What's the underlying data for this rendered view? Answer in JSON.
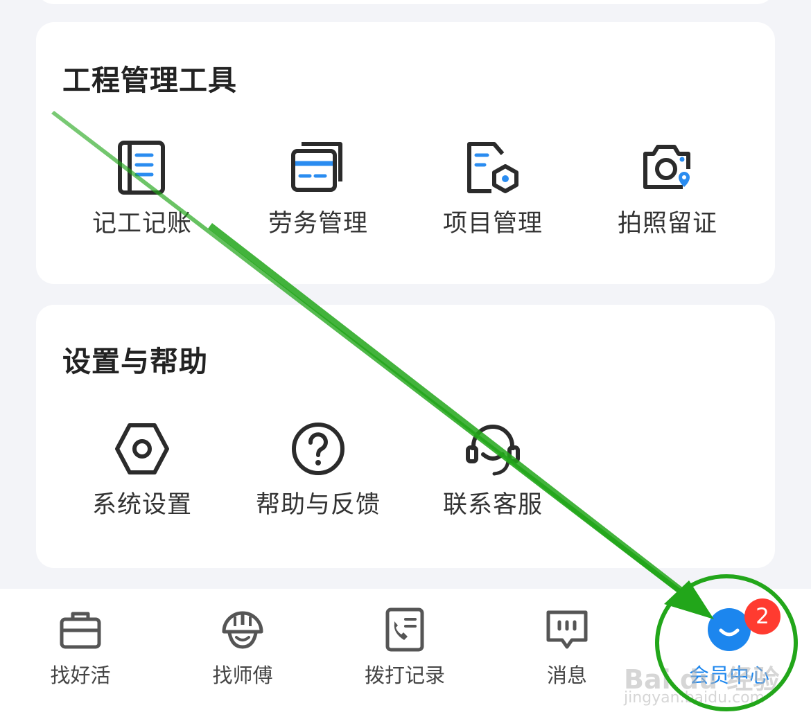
{
  "tools_section": {
    "title": "工程管理工具",
    "items": [
      {
        "label": "记工记账",
        "icon": "notebook-icon"
      },
      {
        "label": "劳务管理",
        "icon": "cards-icon"
      },
      {
        "label": "项目管理",
        "icon": "project-folder-icon"
      },
      {
        "label": "拍照留证",
        "icon": "camera-location-icon"
      }
    ]
  },
  "settings_section": {
    "title": "设置与帮助",
    "items": [
      {
        "label": "系统设置",
        "icon": "gear-icon"
      },
      {
        "label": "帮助与反馈",
        "icon": "help-icon"
      },
      {
        "label": "联系客服",
        "icon": "headset-icon"
      }
    ]
  },
  "tabbar": {
    "tabs": [
      {
        "label": "找好活",
        "icon": "briefcase-icon"
      },
      {
        "label": "找师傅",
        "icon": "helmet-icon"
      },
      {
        "label": "拨打记录",
        "icon": "call-record-icon"
      },
      {
        "label": "消息",
        "icon": "message-icon"
      },
      {
        "label": "会员中心",
        "icon": "member-smile-icon",
        "active": true
      }
    ],
    "badge": "2"
  },
  "watermark": {
    "text": "Bai du 经验",
    "sub": "jingyan.baidu.com"
  },
  "colors": {
    "accent": "#1c86ee",
    "icon_blue": "#2a8cf0",
    "badge": "#ff3b30",
    "annotation": "#22a61a",
    "background": "#f3f4f8"
  }
}
